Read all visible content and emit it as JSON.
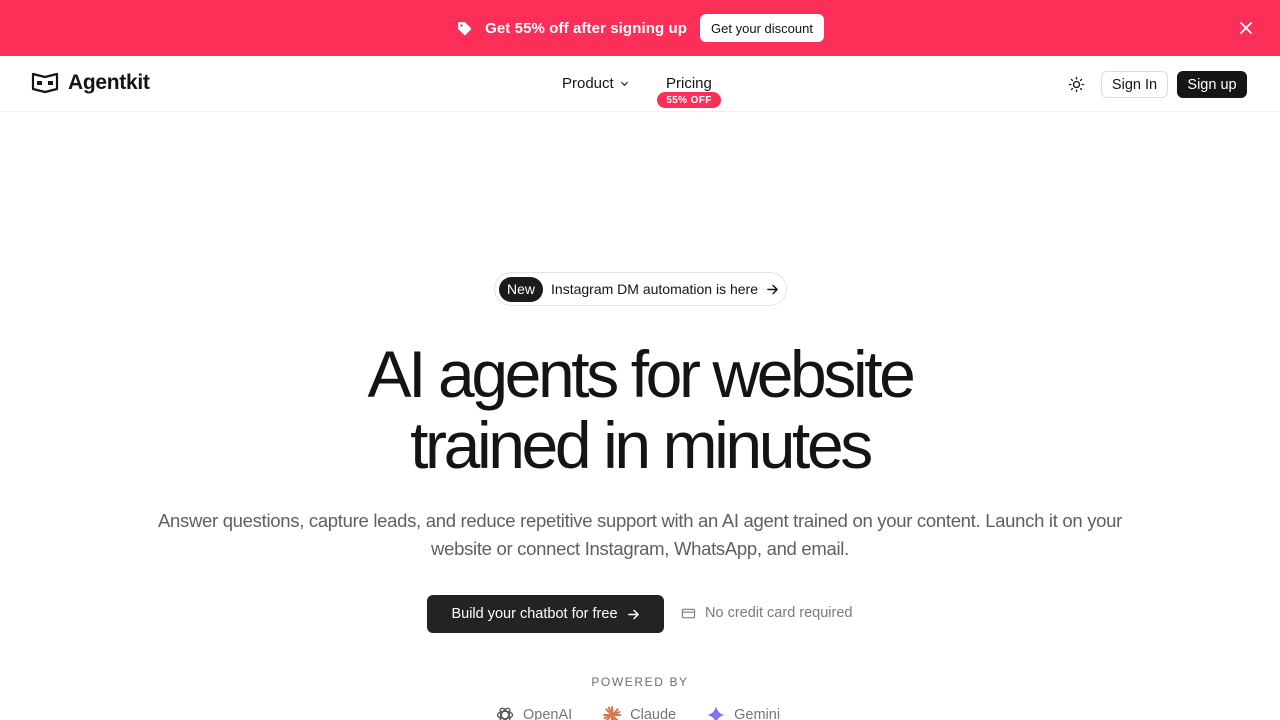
{
  "banner": {
    "icon": "tag-icon",
    "text": "Get 55% off after signing up",
    "button_label": "Get your discount",
    "close_icon": "close-icon",
    "background": "#fb2f58"
  },
  "header": {
    "logo_text": "Agentkit",
    "logo_icon": "agentkit-logo-icon",
    "nav": {
      "product_label": "Product",
      "pricing_label": "Pricing",
      "pricing_badge": "55% OFF"
    },
    "theme_icon": "sun-icon",
    "signin_label": "Sign In",
    "signup_label": "Sign up"
  },
  "hero": {
    "announcement_badge": "New",
    "announcement_text": "Instagram DM automation is here",
    "title_line1": "AI agents for website",
    "title_line2": "trained in minutes",
    "subtitle": "Answer questions, capture leads, and reduce repetitive support with an AI agent trained on your content. Launch it on your website or connect Instagram, WhatsApp, and email.",
    "cta_label": "Build your chatbot for free",
    "no_card_text": "No credit card required",
    "powered_by_label": "POWERED BY",
    "providers": [
      {
        "name": "OpenAI",
        "icon": "openai-icon"
      },
      {
        "name": "Claude",
        "icon": "claude-icon"
      },
      {
        "name": "Gemini",
        "icon": "gemini-icon"
      }
    ]
  },
  "colors": {
    "accent": "#fb2f58",
    "dark": "#161616"
  }
}
